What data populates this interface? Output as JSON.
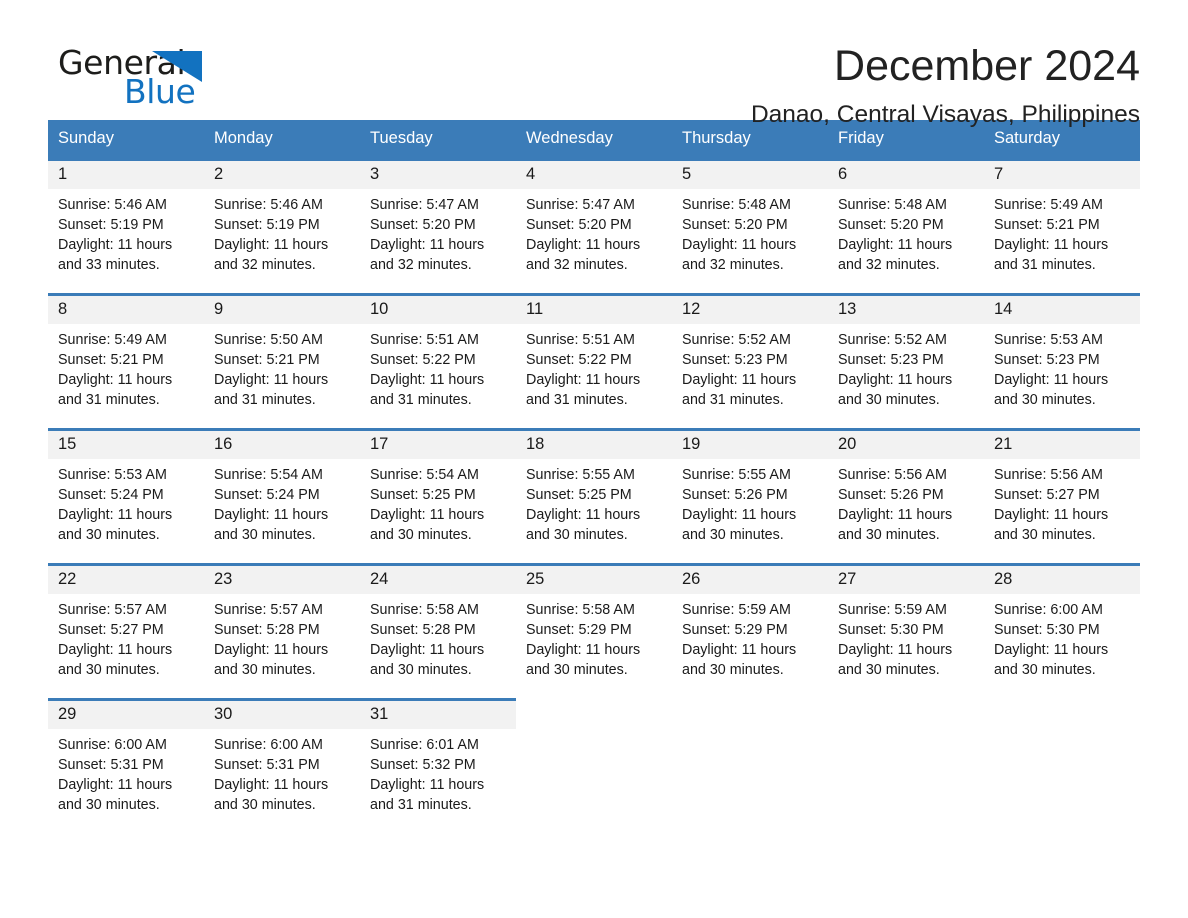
{
  "brand": {
    "name_part1": "General",
    "name_part2": "Blue",
    "accent_color": "#1272c0"
  },
  "header": {
    "title": "December 2024",
    "subtitle": "Danao, Central Visayas, Philippines"
  },
  "theme": {
    "header_blue": "#3b7cb8",
    "daynum_band": "#f2f2f2",
    "text": "#1a1a1a"
  },
  "weekday_headers": [
    "Sunday",
    "Monday",
    "Tuesday",
    "Wednesday",
    "Thursday",
    "Friday",
    "Saturday"
  ],
  "weeks": [
    [
      {
        "day": "1",
        "sunrise": "Sunrise: 5:46 AM",
        "sunset": "Sunset: 5:19 PM",
        "daylight": "Daylight: 11 hours and 33 minutes."
      },
      {
        "day": "2",
        "sunrise": "Sunrise: 5:46 AM",
        "sunset": "Sunset: 5:19 PM",
        "daylight": "Daylight: 11 hours and 32 minutes."
      },
      {
        "day": "3",
        "sunrise": "Sunrise: 5:47 AM",
        "sunset": "Sunset: 5:20 PM",
        "daylight": "Daylight: 11 hours and 32 minutes."
      },
      {
        "day": "4",
        "sunrise": "Sunrise: 5:47 AM",
        "sunset": "Sunset: 5:20 PM",
        "daylight": "Daylight: 11 hours and 32 minutes."
      },
      {
        "day": "5",
        "sunrise": "Sunrise: 5:48 AM",
        "sunset": "Sunset: 5:20 PM",
        "daylight": "Daylight: 11 hours and 32 minutes."
      },
      {
        "day": "6",
        "sunrise": "Sunrise: 5:48 AM",
        "sunset": "Sunset: 5:20 PM",
        "daylight": "Daylight: 11 hours and 32 minutes."
      },
      {
        "day": "7",
        "sunrise": "Sunrise: 5:49 AM",
        "sunset": "Sunset: 5:21 PM",
        "daylight": "Daylight: 11 hours and 31 minutes."
      }
    ],
    [
      {
        "day": "8",
        "sunrise": "Sunrise: 5:49 AM",
        "sunset": "Sunset: 5:21 PM",
        "daylight": "Daylight: 11 hours and 31 minutes."
      },
      {
        "day": "9",
        "sunrise": "Sunrise: 5:50 AM",
        "sunset": "Sunset: 5:21 PM",
        "daylight": "Daylight: 11 hours and 31 minutes."
      },
      {
        "day": "10",
        "sunrise": "Sunrise: 5:51 AM",
        "sunset": "Sunset: 5:22 PM",
        "daylight": "Daylight: 11 hours and 31 minutes."
      },
      {
        "day": "11",
        "sunrise": "Sunrise: 5:51 AM",
        "sunset": "Sunset: 5:22 PM",
        "daylight": "Daylight: 11 hours and 31 minutes."
      },
      {
        "day": "12",
        "sunrise": "Sunrise: 5:52 AM",
        "sunset": "Sunset: 5:23 PM",
        "daylight": "Daylight: 11 hours and 31 minutes."
      },
      {
        "day": "13",
        "sunrise": "Sunrise: 5:52 AM",
        "sunset": "Sunset: 5:23 PM",
        "daylight": "Daylight: 11 hours and 30 minutes."
      },
      {
        "day": "14",
        "sunrise": "Sunrise: 5:53 AM",
        "sunset": "Sunset: 5:23 PM",
        "daylight": "Daylight: 11 hours and 30 minutes."
      }
    ],
    [
      {
        "day": "15",
        "sunrise": "Sunrise: 5:53 AM",
        "sunset": "Sunset: 5:24 PM",
        "daylight": "Daylight: 11 hours and 30 minutes."
      },
      {
        "day": "16",
        "sunrise": "Sunrise: 5:54 AM",
        "sunset": "Sunset: 5:24 PM",
        "daylight": "Daylight: 11 hours and 30 minutes."
      },
      {
        "day": "17",
        "sunrise": "Sunrise: 5:54 AM",
        "sunset": "Sunset: 5:25 PM",
        "daylight": "Daylight: 11 hours and 30 minutes."
      },
      {
        "day": "18",
        "sunrise": "Sunrise: 5:55 AM",
        "sunset": "Sunset: 5:25 PM",
        "daylight": "Daylight: 11 hours and 30 minutes."
      },
      {
        "day": "19",
        "sunrise": "Sunrise: 5:55 AM",
        "sunset": "Sunset: 5:26 PM",
        "daylight": "Daylight: 11 hours and 30 minutes."
      },
      {
        "day": "20",
        "sunrise": "Sunrise: 5:56 AM",
        "sunset": "Sunset: 5:26 PM",
        "daylight": "Daylight: 11 hours and 30 minutes."
      },
      {
        "day": "21",
        "sunrise": "Sunrise: 5:56 AM",
        "sunset": "Sunset: 5:27 PM",
        "daylight": "Daylight: 11 hours and 30 minutes."
      }
    ],
    [
      {
        "day": "22",
        "sunrise": "Sunrise: 5:57 AM",
        "sunset": "Sunset: 5:27 PM",
        "daylight": "Daylight: 11 hours and 30 minutes."
      },
      {
        "day": "23",
        "sunrise": "Sunrise: 5:57 AM",
        "sunset": "Sunset: 5:28 PM",
        "daylight": "Daylight: 11 hours and 30 minutes."
      },
      {
        "day": "24",
        "sunrise": "Sunrise: 5:58 AM",
        "sunset": "Sunset: 5:28 PM",
        "daylight": "Daylight: 11 hours and 30 minutes."
      },
      {
        "day": "25",
        "sunrise": "Sunrise: 5:58 AM",
        "sunset": "Sunset: 5:29 PM",
        "daylight": "Daylight: 11 hours and 30 minutes."
      },
      {
        "day": "26",
        "sunrise": "Sunrise: 5:59 AM",
        "sunset": "Sunset: 5:29 PM",
        "daylight": "Daylight: 11 hours and 30 minutes."
      },
      {
        "day": "27",
        "sunrise": "Sunrise: 5:59 AM",
        "sunset": "Sunset: 5:30 PM",
        "daylight": "Daylight: 11 hours and 30 minutes."
      },
      {
        "day": "28",
        "sunrise": "Sunrise: 6:00 AM",
        "sunset": "Sunset: 5:30 PM",
        "daylight": "Daylight: 11 hours and 30 minutes."
      }
    ],
    [
      {
        "day": "29",
        "sunrise": "Sunrise: 6:00 AM",
        "sunset": "Sunset: 5:31 PM",
        "daylight": "Daylight: 11 hours and 30 minutes."
      },
      {
        "day": "30",
        "sunrise": "Sunrise: 6:00 AM",
        "sunset": "Sunset: 5:31 PM",
        "daylight": "Daylight: 11 hours and 30 minutes."
      },
      {
        "day": "31",
        "sunrise": "Sunrise: 6:01 AM",
        "sunset": "Sunset: 5:32 PM",
        "daylight": "Daylight: 11 hours and 31 minutes."
      },
      {
        "day": "",
        "sunrise": "",
        "sunset": "",
        "daylight": ""
      },
      {
        "day": "",
        "sunrise": "",
        "sunset": "",
        "daylight": ""
      },
      {
        "day": "",
        "sunrise": "",
        "sunset": "",
        "daylight": ""
      },
      {
        "day": "",
        "sunrise": "",
        "sunset": "",
        "daylight": ""
      }
    ]
  ]
}
